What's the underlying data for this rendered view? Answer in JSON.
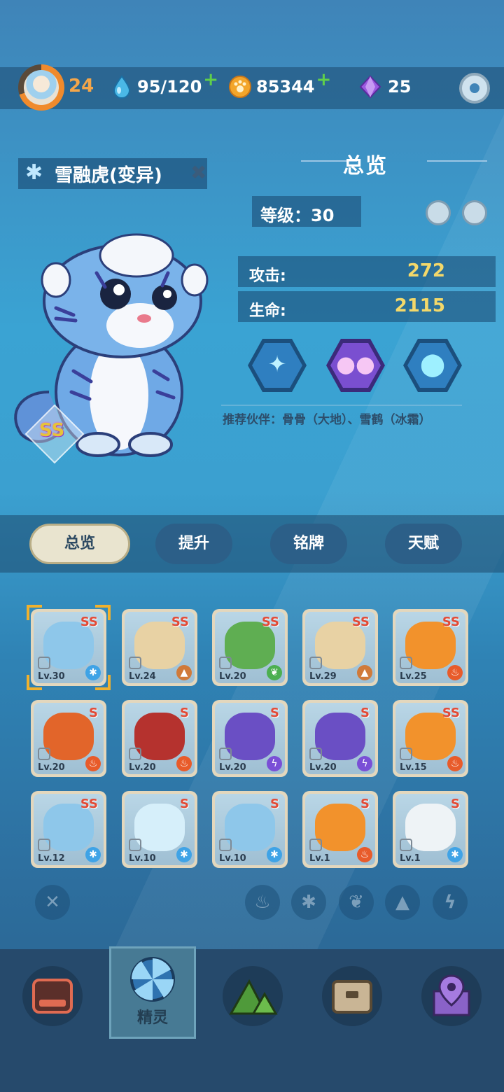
{
  "topbar": {
    "player_level": "24",
    "energy": "95/120",
    "coins": "85344",
    "gems": "25",
    "plus": "+"
  },
  "creature": {
    "name": "雪融虎(变异)",
    "rank": "SS"
  },
  "overview": {
    "title": "总览",
    "level_label": "等级：30",
    "attack_label": "攻击:",
    "attack_value": "272",
    "hp_label": "生命:",
    "hp_value": "2115",
    "partner_text": "推荐伙伴：骨骨（大地）、雪鹤（冰霜）"
  },
  "tabs": [
    {
      "label": "总览",
      "active": true
    },
    {
      "label": "提升",
      "active": false
    },
    {
      "label": "铭牌",
      "active": false
    },
    {
      "label": "天赋",
      "active": false
    }
  ],
  "cards": [
    {
      "rank": "SS",
      "level": "Lv.30",
      "element": "ice",
      "color": "#8ec7ea",
      "selected": true
    },
    {
      "rank": "SS",
      "level": "Lv.24",
      "element": "earth",
      "color": "#e8d2a4",
      "selected": false
    },
    {
      "rank": "SS",
      "level": "Lv.20",
      "element": "leaf",
      "color": "#5fae52",
      "selected": false
    },
    {
      "rank": "SS",
      "level": "Lv.29",
      "element": "earth",
      "color": "#e8d2a4",
      "selected": false
    },
    {
      "rank": "SS",
      "level": "Lv.25",
      "element": "fire",
      "color": "#f2922c",
      "selected": false
    },
    {
      "rank": "S",
      "level": "Lv.20",
      "element": "fire",
      "color": "#e2652a",
      "selected": false
    },
    {
      "rank": "S",
      "level": "Lv.20",
      "element": "fire",
      "color": "#b5322e",
      "selected": false
    },
    {
      "rank": "S",
      "level": "Lv.20",
      "element": "thunder",
      "color": "#6a4fc4",
      "selected": false
    },
    {
      "rank": "S",
      "level": "Lv.20",
      "element": "thunder",
      "color": "#6a4fc4",
      "selected": false
    },
    {
      "rank": "SS",
      "level": "Lv.15",
      "element": "fire",
      "color": "#f2922c",
      "selected": false
    },
    {
      "rank": "SS",
      "level": "Lv.12",
      "element": "ice",
      "color": "#8ec7ea",
      "selected": false
    },
    {
      "rank": "S",
      "level": "Lv.10",
      "element": "ice",
      "color": "#d6effa",
      "selected": false
    },
    {
      "rank": "S",
      "level": "Lv.10",
      "element": "ice",
      "color": "#8ec7ea",
      "selected": false
    },
    {
      "rank": "S",
      "level": "Lv.1",
      "element": "fire",
      "color": "#f2922c",
      "selected": false
    },
    {
      "rank": "S",
      "level": "Lv.1",
      "element": "ice",
      "color": "#eef3f6",
      "selected": false
    }
  ],
  "element_glyphs": {
    "ice": "✱",
    "earth": "▲",
    "leaf": "❦",
    "fire": "♨",
    "thunder": "ϟ"
  },
  "element_colors": {
    "ice": "#3fa3e6",
    "earth": "#d07a3a",
    "leaf": "#4caf50",
    "fire": "#e85b2a",
    "thunder": "#7a4fd6"
  },
  "filters": [
    "fire-filter",
    "ice-filter",
    "leaf-filter",
    "earth-filter",
    "thunder-filter"
  ],
  "nav": {
    "active_label": "精灵"
  }
}
